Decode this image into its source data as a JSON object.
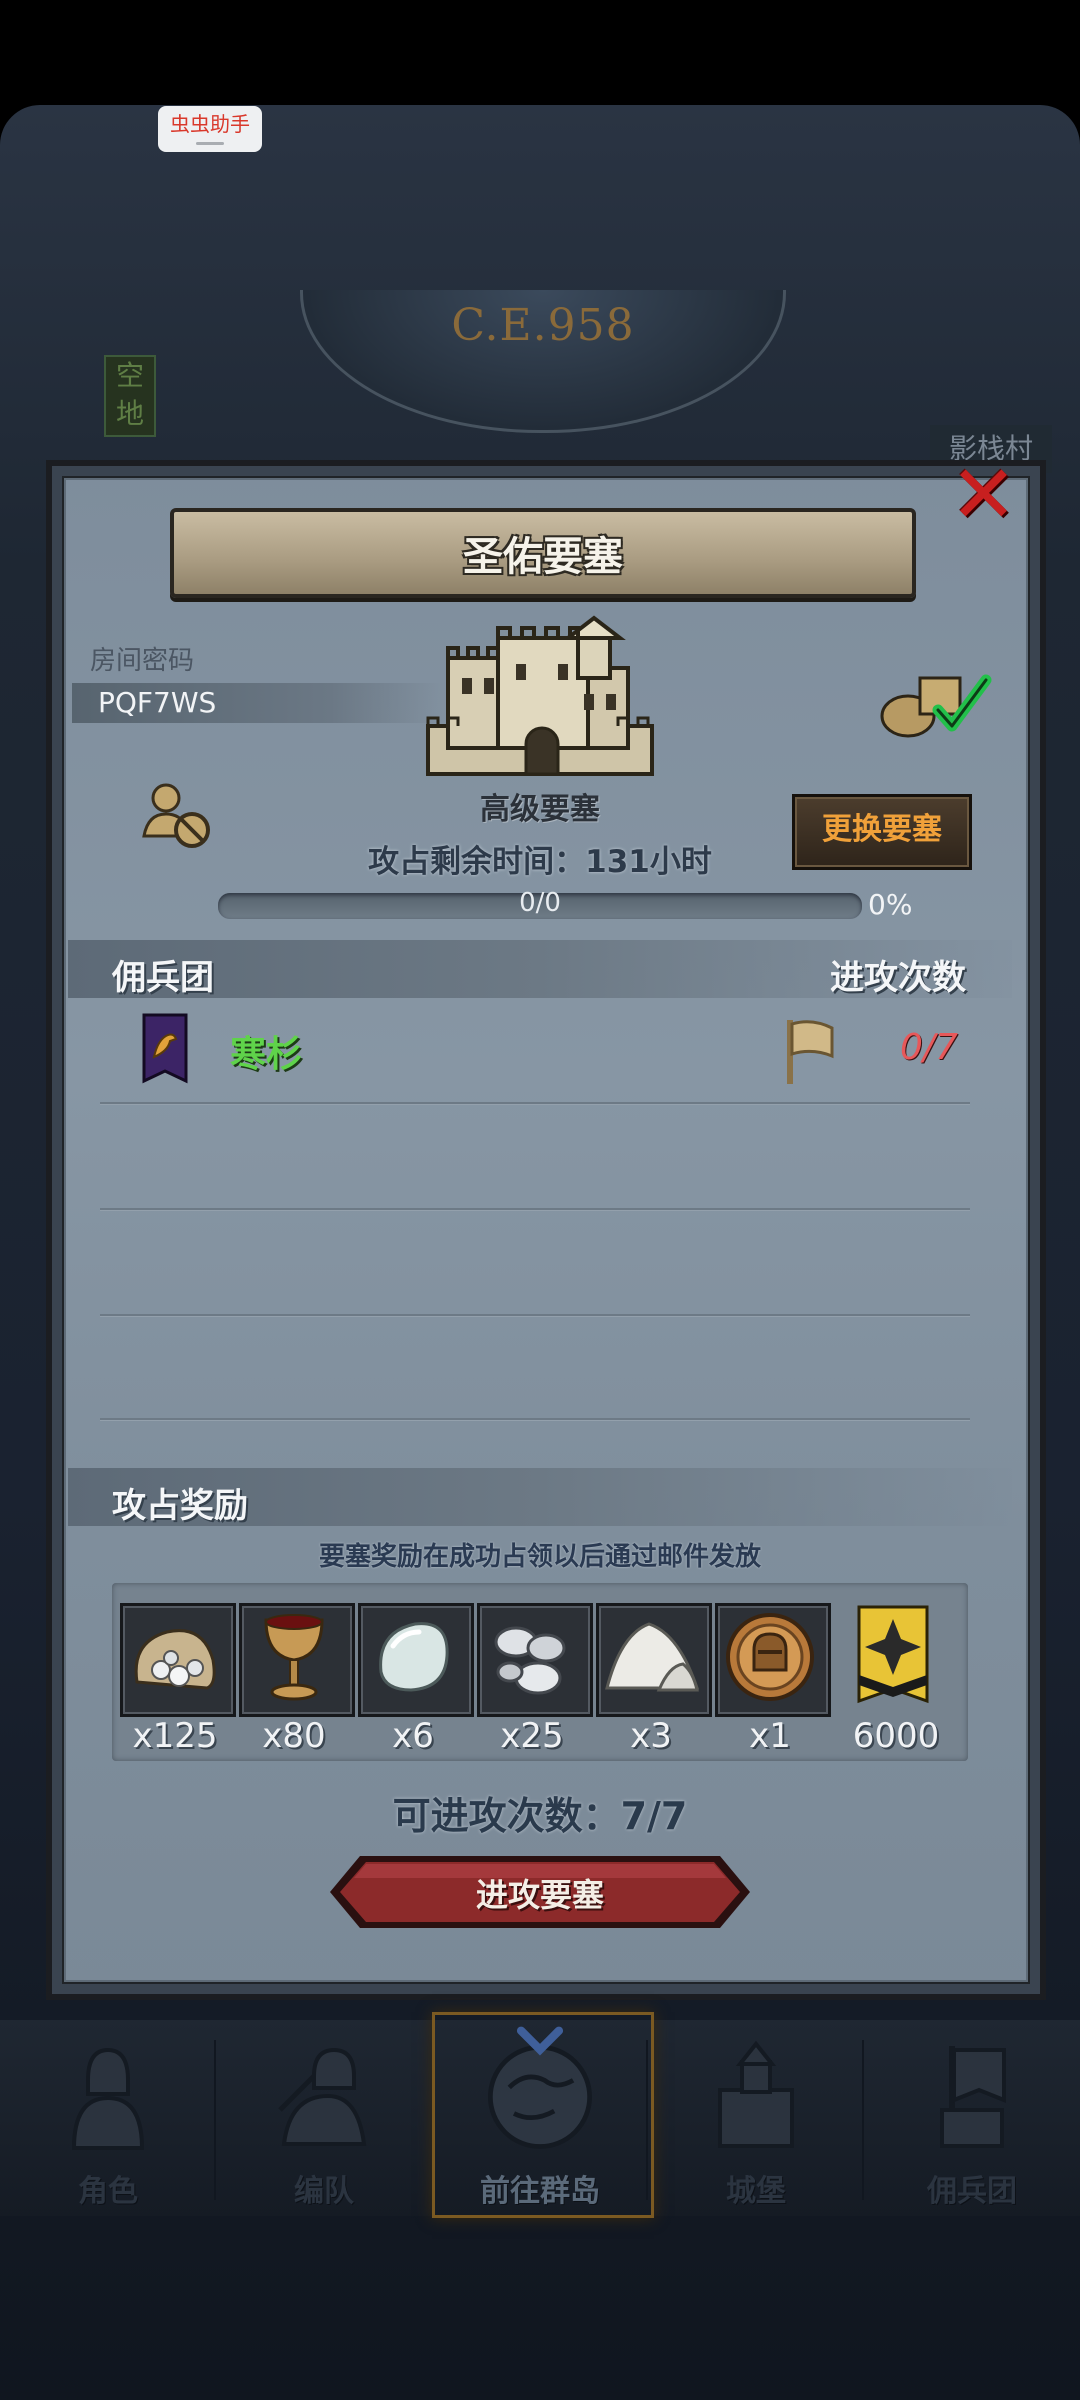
{
  "overlay": {
    "helper_badge": "虫虫助手",
    "year": "C.E.958",
    "left_sign": "空地",
    "right_sign": "影栈村"
  },
  "dialog": {
    "title": "圣佑要塞",
    "room_code_label": "房间密码",
    "room_code": "PQF7WS",
    "fortress_level": "高级要塞",
    "change_button": "更换要塞",
    "remaining_time": "攻占剩余时间：131小时",
    "progress_text": "0/0",
    "progress_percent": "0%",
    "progress_value": 0,
    "section_mercenary": "佣兵团",
    "section_attacks": "进攻次数",
    "mercenary": {
      "name": "寒杉",
      "attacks": "0/7",
      "flag_icon": "wolf-crest-flag-icon"
    },
    "section_rewards": "攻占奖励",
    "reward_note": "要塞奖励在成功占领以后通过邮件发放",
    "rewards": [
      {
        "icon": "silver-ore-sack-icon",
        "count": "x125"
      },
      {
        "icon": "chalice-icon",
        "count": "x80"
      },
      {
        "icon": "pearl-stone-icon",
        "count": "x6"
      },
      {
        "icon": "silver-nuggets-icon",
        "count": "x25"
      },
      {
        "icon": "salt-pile-icon",
        "count": "x3"
      },
      {
        "icon": "knight-medal-icon",
        "count": "x1"
      },
      {
        "icon": "gold-banner-icon",
        "count": "6000"
      }
    ],
    "available_attacks": "可进攻次数：7/7",
    "attack_button": "进攻要塞"
  },
  "nav": {
    "tabs": [
      {
        "label": "角色",
        "icon": "knight-icon"
      },
      {
        "label": "编队",
        "icon": "formation-icon"
      },
      {
        "label": "前往群岛",
        "icon": "globe-icon",
        "active": true
      },
      {
        "label": "城堡",
        "icon": "castle-icon"
      },
      {
        "label": "佣兵团",
        "icon": "mercenary-icon"
      }
    ]
  },
  "colors": {
    "accent_red": "#c81f1f",
    "merc_green": "#5fd34a",
    "attack_red": "#e7585a",
    "change_orange": "#f0a13a"
  }
}
